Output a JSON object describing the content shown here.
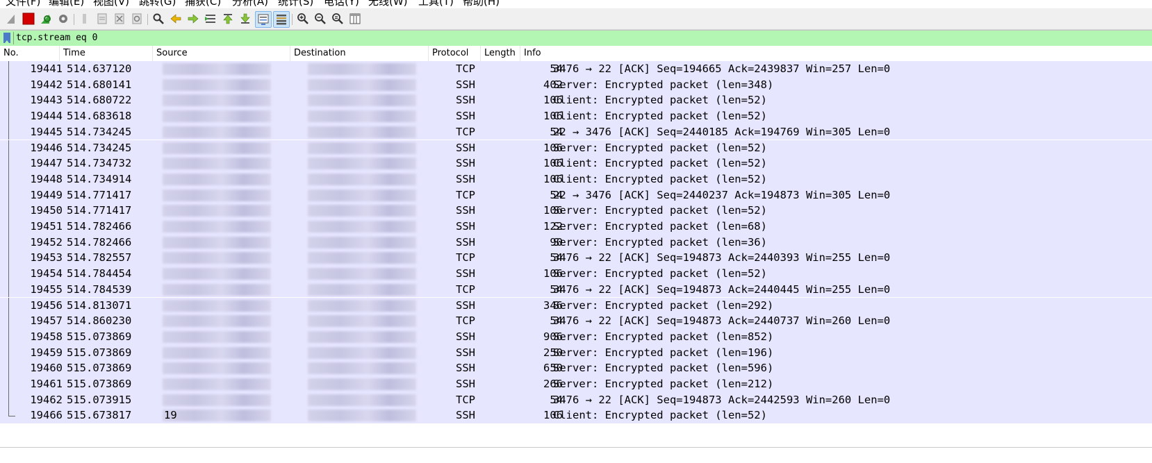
{
  "menu": [
    "文件(F)",
    "编辑(E)",
    "视图(V)",
    "跳转(G)",
    "捕获(C)",
    "分析(A)",
    "统计(S)",
    "电话(Y)",
    "无线(W)",
    "工具(T)",
    "帮助(H)"
  ],
  "filter": {
    "value": "tcp.stream eq 0"
  },
  "columns": {
    "no": "No.",
    "time": "Time",
    "source": "Source",
    "destination": "Destination",
    "protocol": "Protocol",
    "length": "Length",
    "info": "Info"
  },
  "colors": {
    "filter_bg": "#b3f5b3",
    "row_bg": "#e7e6ff"
  },
  "packets": [
    {
      "no": "19441",
      "time": "514.637120",
      "protocol": "TCP",
      "length": "54",
      "info": "3476 → 22 [ACK] Seq=194665 Ack=2439837 Win=257 Len=0"
    },
    {
      "no": "19442",
      "time": "514.680141",
      "protocol": "SSH",
      "length": "402",
      "info": "Server: Encrypted packet (len=348)"
    },
    {
      "no": "19443",
      "time": "514.680722",
      "protocol": "SSH",
      "length": "106",
      "info": "Client: Encrypted packet (len=52)"
    },
    {
      "no": "19444",
      "time": "514.683618",
      "protocol": "SSH",
      "length": "106",
      "info": "Client: Encrypted packet (len=52)"
    },
    {
      "no": "19445",
      "time": "514.734245",
      "protocol": "TCP",
      "length": "54",
      "info": "22 → 3476 [ACK] Seq=2440185 Ack=194769 Win=305 Len=0"
    },
    {
      "no": "19446",
      "time": "514.734245",
      "protocol": "SSH",
      "length": "106",
      "info": "Server: Encrypted packet (len=52)"
    },
    {
      "no": "19447",
      "time": "514.734732",
      "protocol": "SSH",
      "length": "106",
      "info": "Client: Encrypted packet (len=52)"
    },
    {
      "no": "19448",
      "time": "514.734914",
      "protocol": "SSH",
      "length": "106",
      "info": "Client: Encrypted packet (len=52)"
    },
    {
      "no": "19449",
      "time": "514.771417",
      "protocol": "TCP",
      "length": "54",
      "info": "22 → 3476 [ACK] Seq=2440237 Ack=194873 Win=305 Len=0"
    },
    {
      "no": "19450",
      "time": "514.771417",
      "protocol": "SSH",
      "length": "106",
      "info": "Server: Encrypted packet (len=52)"
    },
    {
      "no": "19451",
      "time": "514.782466",
      "protocol": "SSH",
      "length": "122",
      "info": "Server: Encrypted packet (len=68)"
    },
    {
      "no": "19452",
      "time": "514.782466",
      "protocol": "SSH",
      "length": "90",
      "info": "Server: Encrypted packet (len=36)"
    },
    {
      "no": "19453",
      "time": "514.782557",
      "protocol": "TCP",
      "length": "54",
      "info": "3476 → 22 [ACK] Seq=194873 Ack=2440393 Win=255 Len=0"
    },
    {
      "no": "19454",
      "time": "514.784454",
      "protocol": "SSH",
      "length": "106",
      "info": "Server: Encrypted packet (len=52)"
    },
    {
      "no": "19455",
      "time": "514.784539",
      "protocol": "TCP",
      "length": "54",
      "info": "3476 → 22 [ACK] Seq=194873 Ack=2440445 Win=255 Len=0"
    },
    {
      "no": "19456",
      "time": "514.813071",
      "protocol": "SSH",
      "length": "346",
      "info": "Server: Encrypted packet (len=292)"
    },
    {
      "no": "19457",
      "time": "514.860230",
      "protocol": "TCP",
      "length": "54",
      "info": "3476 → 22 [ACK] Seq=194873 Ack=2440737 Win=260 Len=0"
    },
    {
      "no": "19458",
      "time": "515.073869",
      "protocol": "SSH",
      "length": "906",
      "info": "Server: Encrypted packet (len=852)"
    },
    {
      "no": "19459",
      "time": "515.073869",
      "protocol": "SSH",
      "length": "250",
      "info": "Server: Encrypted packet (len=196)"
    },
    {
      "no": "19460",
      "time": "515.073869",
      "protocol": "SSH",
      "length": "650",
      "info": "Server: Encrypted packet (len=596)"
    },
    {
      "no": "19461",
      "time": "515.073869",
      "protocol": "SSH",
      "length": "266",
      "info": "Server: Encrypted packet (len=212)"
    },
    {
      "no": "19462",
      "time": "515.073915",
      "protocol": "TCP",
      "length": "54",
      "info": "3476 → 22 [ACK] Seq=194873 Ack=2442593 Win=260 Len=0"
    },
    {
      "no": "19466",
      "time": "515.673817",
      "protocol": "SSH",
      "length": "106",
      "info": "Client: Encrypted packet (len=52)",
      "source_partial": "19"
    }
  ]
}
